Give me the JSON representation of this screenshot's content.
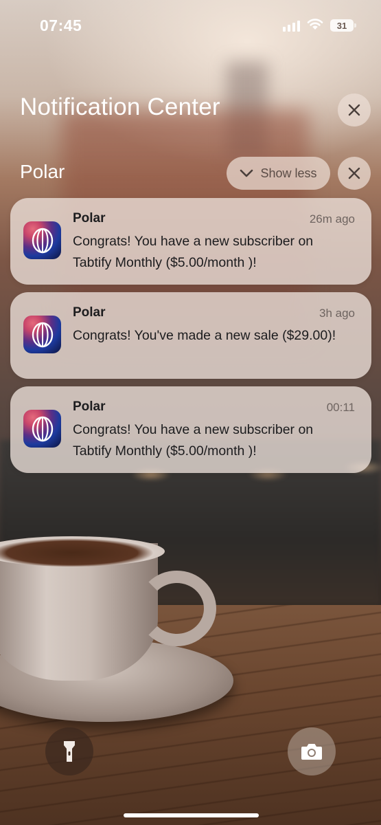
{
  "status_bar": {
    "time": "07:45",
    "battery": "31"
  },
  "notification_center": {
    "title": "Notification Center"
  },
  "group": {
    "name": "Polar",
    "show_less_label": "Show less"
  },
  "notifications": [
    {
      "app": "Polar",
      "time": "26m ago",
      "body": "Congrats! You have a new subscriber on Tabtify Monthly ($5.00/month )!"
    },
    {
      "app": "Polar",
      "time": "3h ago",
      "body": "Congrats! You've made a new sale ($29.00)!"
    },
    {
      "app": "Polar",
      "time": "00:11",
      "body": "Congrats! You have a new subscriber on Tabtify Monthly ($5.00/month )!"
    }
  ],
  "icons": {
    "close": "close-icon",
    "chevron": "chevron-down-icon",
    "app": "polar-app-icon",
    "flashlight": "flashlight-icon",
    "camera": "camera-icon",
    "signal": "cellular-signal-icon",
    "wifi": "wifi-icon",
    "battery": "battery-icon"
  },
  "colors": {
    "card_background": "#ece0da",
    "button_background": "#ebded6"
  }
}
